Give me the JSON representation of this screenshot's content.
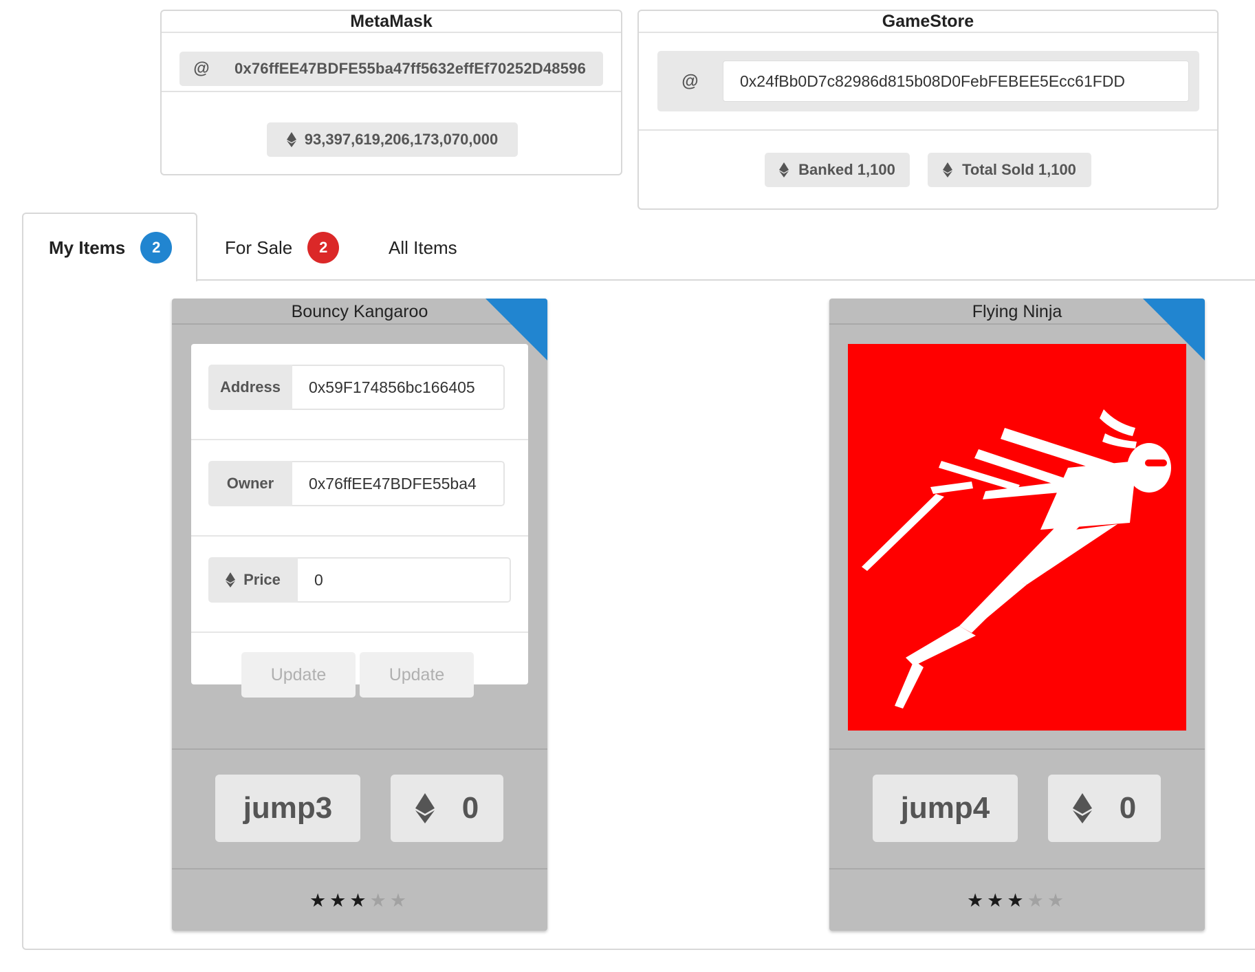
{
  "metamask": {
    "title": "MetaMask",
    "address_prefix": "@",
    "address": "0x76ffEE47BDFE55ba47ff5632effEf70252D48596",
    "balance": "93,397,619,206,173,070,000"
  },
  "gamestore": {
    "title": "GameStore",
    "address_prefix": "@",
    "address": "0x24fBb0D7c82986d815b08D0FebFEBEE5Ecc61FDD",
    "banked": "Banked 1,100",
    "total_sold": "Total Sold 1,100"
  },
  "tabs": [
    {
      "label": "My Items",
      "badge": "2",
      "badge_color": "#2185d0",
      "active": true
    },
    {
      "label": "For Sale",
      "badge": "2",
      "badge_color": "#db2828",
      "active": false
    },
    {
      "label": "All Items",
      "active": false
    }
  ],
  "cards": [
    {
      "title": "Bouncy Kangaroo",
      "address_label": "Address",
      "address_value": "0x59F174856bc166405",
      "owner_label": "Owner",
      "owner_value": "0x76ffEE47BDFE55ba4",
      "price_label": "Price",
      "price_value": "0",
      "update_buttons": [
        "Update",
        "Update"
      ],
      "name_button": "jump3",
      "price_button": "0",
      "rating": 3,
      "rating_max": 5,
      "corner_color": "#2185d0"
    },
    {
      "title": "Flying Ninja",
      "image_icon": "flying-ninja-icon",
      "image_background": "#ff0000",
      "name_button": "jump4",
      "price_button": "0",
      "rating": 3,
      "rating_max": 5,
      "corner_color": "#2185d0"
    }
  ]
}
